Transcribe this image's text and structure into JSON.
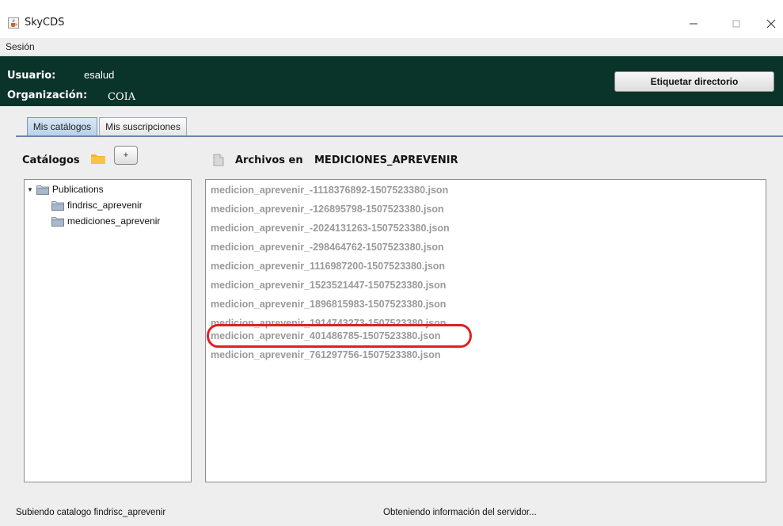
{
  "window": {
    "title": "SkyCDS",
    "icon": "java-cup-icon"
  },
  "menubar": {
    "items": [
      "Sesión"
    ]
  },
  "header": {
    "user_label": "Usuario:",
    "user_value": "esalud",
    "org_label": "Organización:",
    "org_value": "COIA",
    "tag_button": "Etiquetar directorio",
    "bg_color": "#0a3329"
  },
  "tabs": [
    {
      "label": "Mis catálogos",
      "active": true
    },
    {
      "label": "Mis suscripciones",
      "active": false
    }
  ],
  "catalogs": {
    "title": "Catálogos",
    "add_label": "+",
    "tree": {
      "root": "Publications",
      "children": [
        "findrisc_aprevenir",
        "mediciones_aprevenir"
      ]
    }
  },
  "files": {
    "title_prefix": "Archivos en",
    "directory": "MEDICIONES_APREVENIR",
    "items": [
      "medicion_aprevenir_-1118376892-1507523380.json",
      "medicion_aprevenir_-126895798-1507523380.json",
      "medicion_aprevenir_-2024131263-1507523380.json",
      "medicion_aprevenir_-298464762-1507523380.json",
      "medicion_aprevenir_1116987200-1507523380.json",
      "medicion_aprevenir_1523521447-1507523380.json",
      "medicion_aprevenir_1896815983-1507523380.json",
      "medicion_aprevenir_1914743273-1507523380.json",
      "medicion_aprevenir_401486785-1507523380.json",
      "medicion_aprevenir_761297756-1507523380.json"
    ],
    "highlighted_item": "medicion_aprevenir_401486785-1507523380.json",
    "highlight_color": "#e02020"
  },
  "status": {
    "left": "Subiendo catalogo findrisc_aprevenir",
    "right": "Obteniendo información del servidor..."
  }
}
